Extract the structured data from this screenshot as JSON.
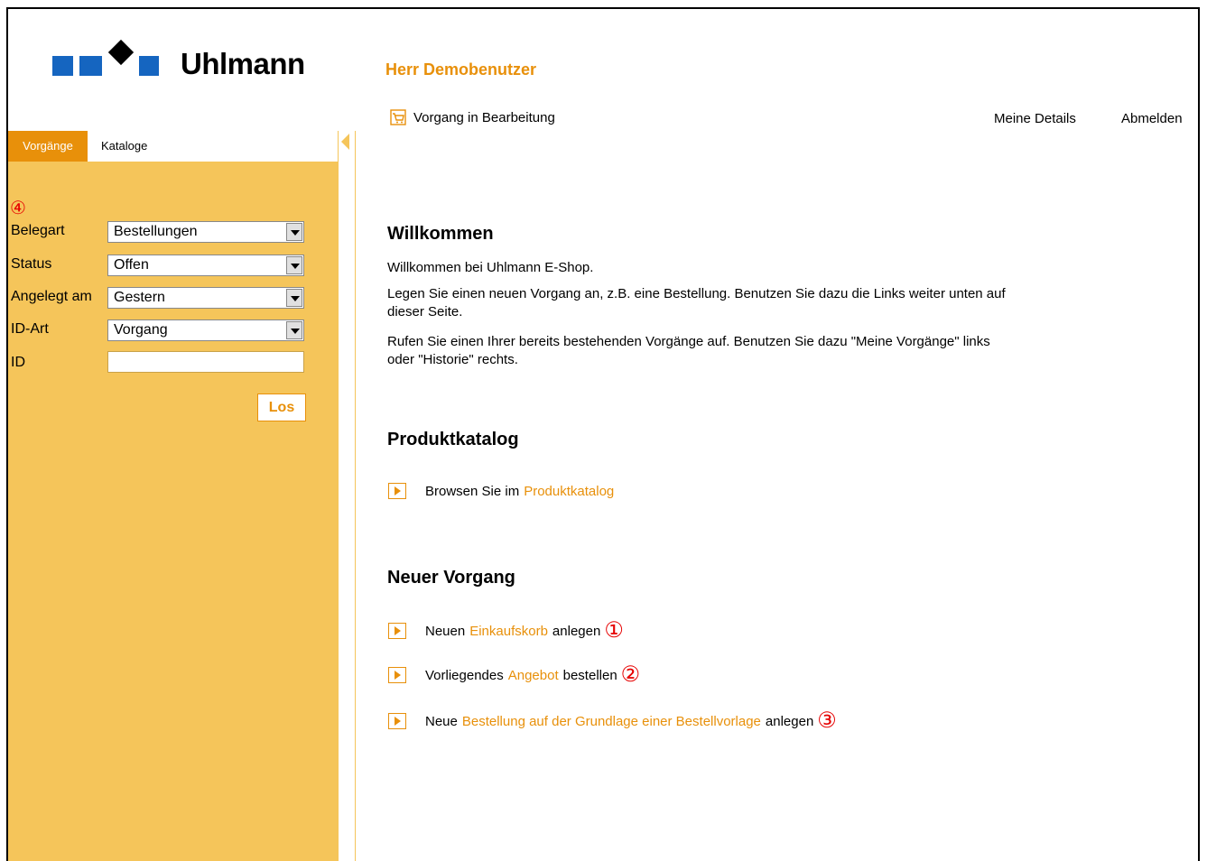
{
  "header": {
    "brand": "Uhlmann",
    "user": "Herr Demobenutzer",
    "current_process": "Vorgang in Bearbeitung",
    "my_details": "Meine Details",
    "logout": "Abmelden"
  },
  "sidebar": {
    "tabs": [
      {
        "label": "Vorgänge",
        "active": true
      },
      {
        "label": "Kataloge",
        "active": false
      }
    ],
    "marker": "④",
    "fields": {
      "belegart": {
        "label": "Belegart",
        "value": "Bestellungen"
      },
      "status": {
        "label": "Status",
        "value": "Offen"
      },
      "angelegt": {
        "label": "Angelegt am",
        "value": "Gestern"
      },
      "idart": {
        "label": "ID-Art",
        "value": "Vorgang"
      },
      "id": {
        "label": "ID",
        "value": ""
      }
    },
    "go_button": "Los"
  },
  "main": {
    "welcome": {
      "title": "Willkommen",
      "p1": "Willkommen bei Uhlmann E-Shop.",
      "p2": "Legen Sie einen neuen Vorgang an, z.B. eine Bestellung. Benutzen Sie dazu die Links weiter unten auf dieser Seite.",
      "p3": "Rufen Sie einen Ihrer bereits bestehenden Vorgänge auf. Benutzen Sie dazu \"Meine Vorgänge\" links oder \"Historie\" rechts."
    },
    "catalog": {
      "title": "Produktkatalog",
      "prefix": "Browsen Sie im",
      "link": "Produktkatalog"
    },
    "new_process": {
      "title": "Neuer Vorgang",
      "items": [
        {
          "prefix": "Neuen",
          "link": "Einkaufskorb",
          "suffix": "anlegen",
          "marker": "①"
        },
        {
          "prefix": "Vorliegendes",
          "link": "Angebot",
          "suffix": "bestellen",
          "marker": "②"
        },
        {
          "prefix": "Neue",
          "link": "Bestellung auf der Grundlage einer Bestellvorlage",
          "suffix": "anlegen",
          "marker": "③"
        }
      ]
    }
  },
  "colors": {
    "accent": "#e8900a",
    "sidebar": "#f5c55a",
    "logo_blue": "#1565c0",
    "marker": "#e60000"
  }
}
